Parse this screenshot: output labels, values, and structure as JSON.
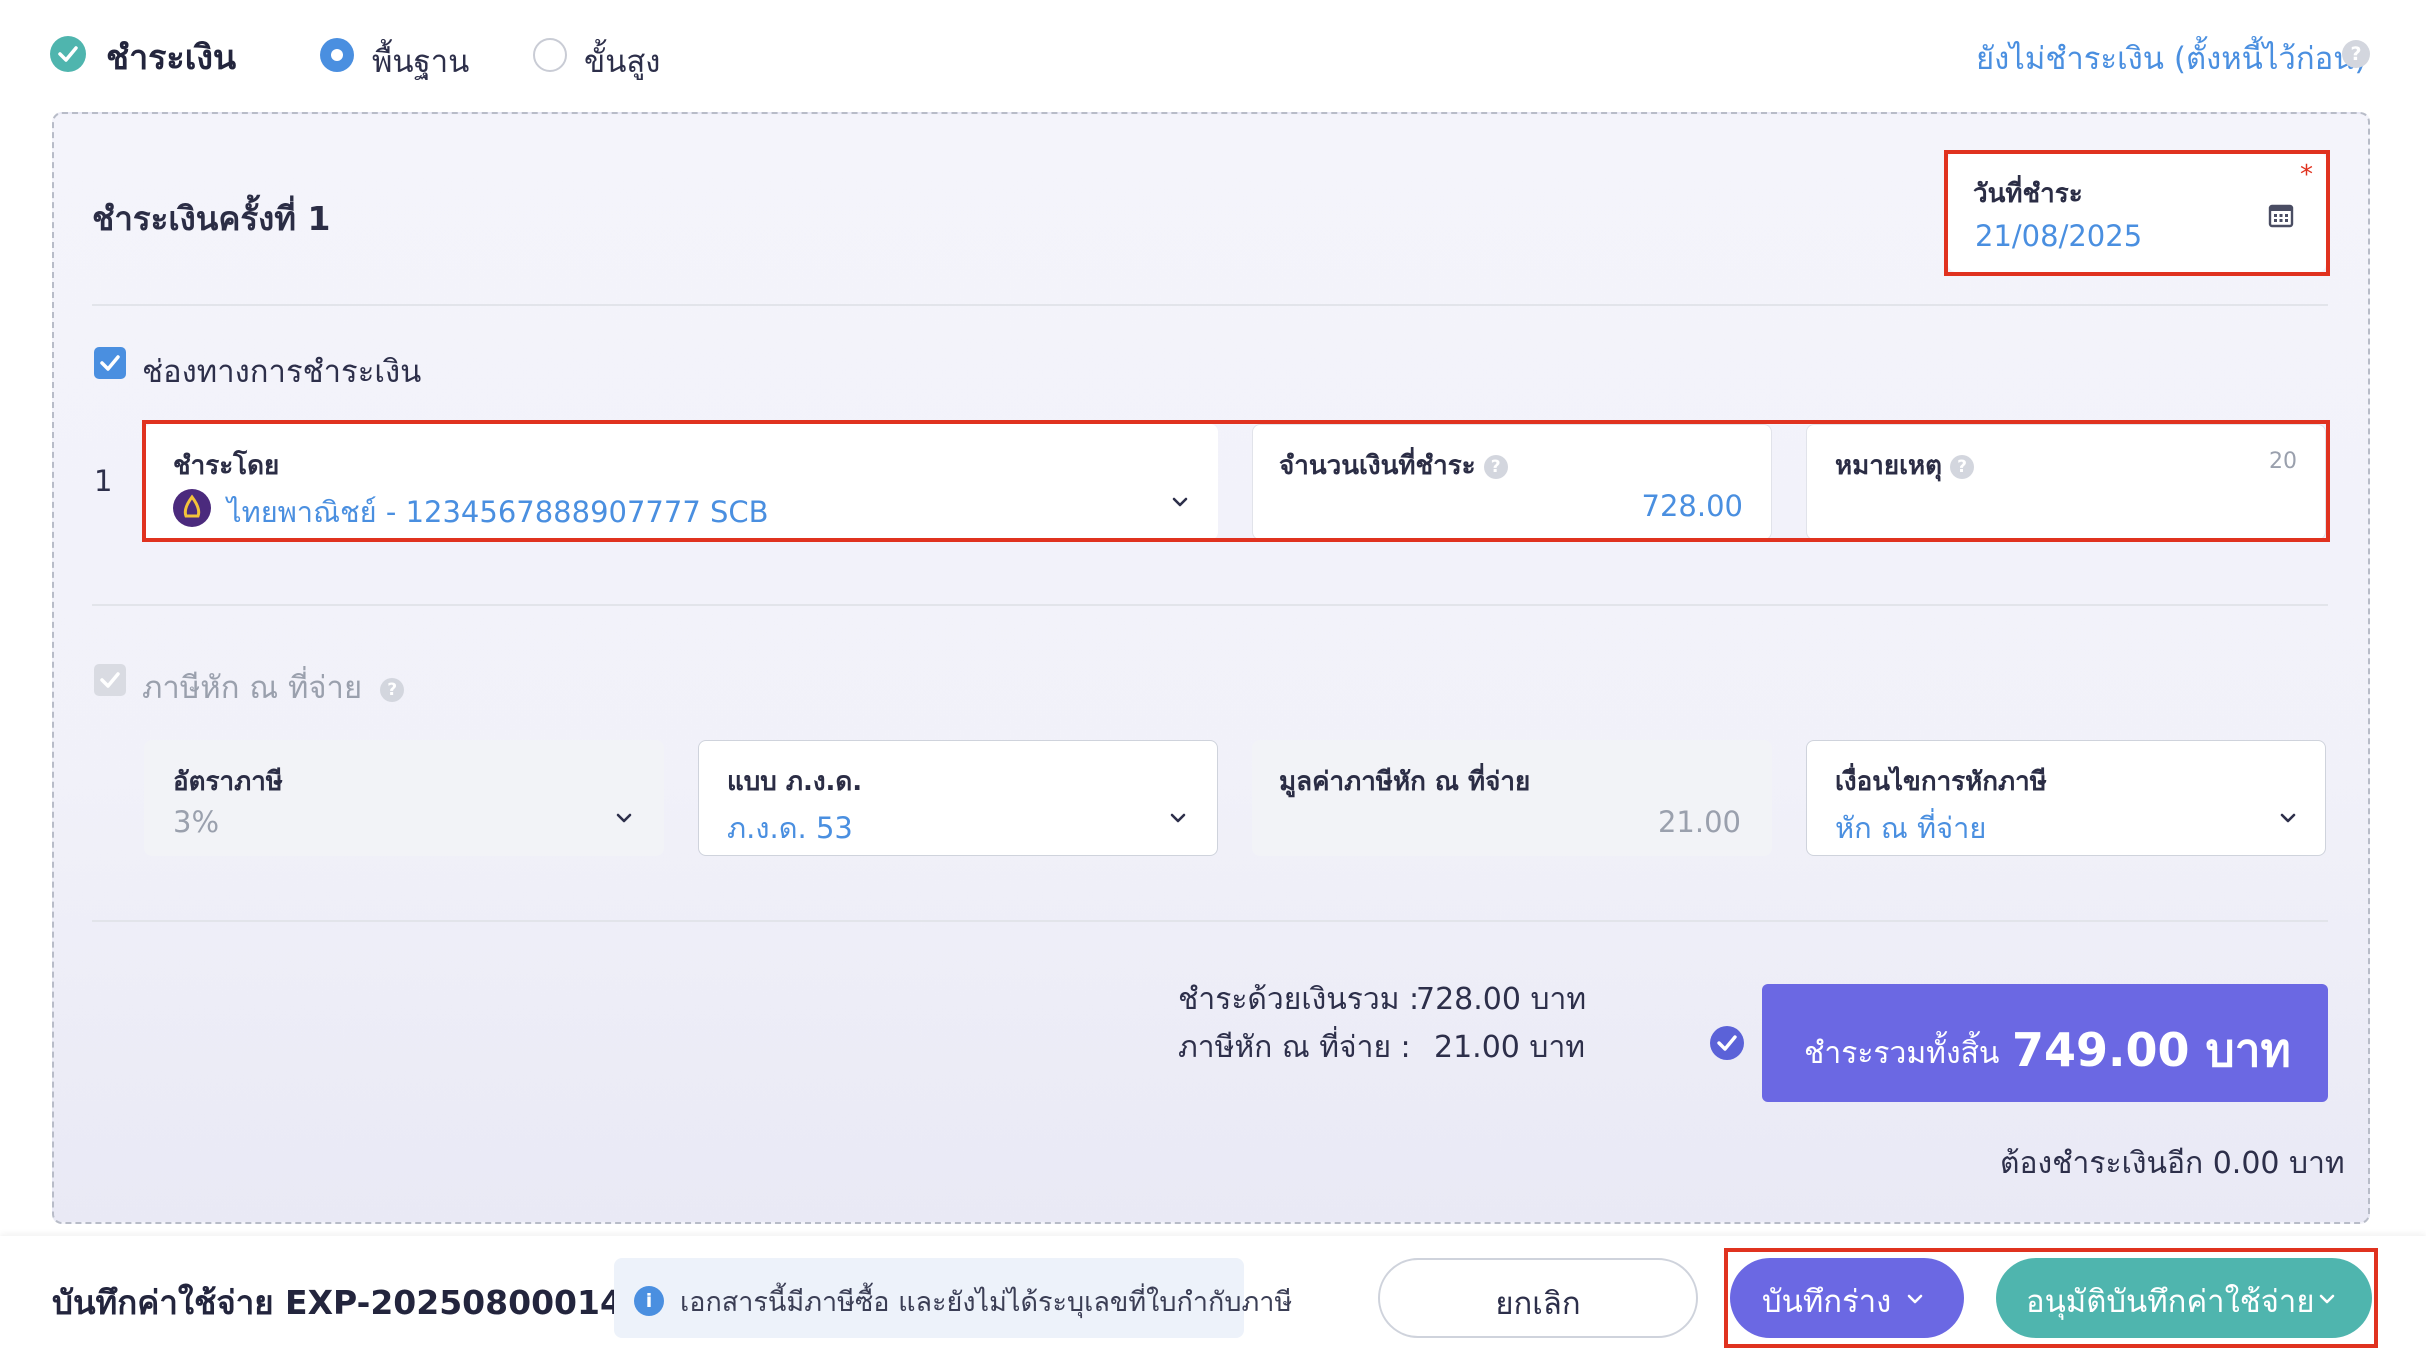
{
  "header": {
    "title": "ชำระเงิน",
    "modes": [
      {
        "label": "พื้นฐาน",
        "selected": true
      },
      {
        "label": "ขั้นสูง",
        "selected": false
      }
    ],
    "unpaid_link": "ยังไม่ชำระเงิน (ตั้งหนี้ไว้ก่อน)"
  },
  "payment": {
    "title": "ชำระเงินครั้งที่ 1",
    "date_label": "วันที่ชำระ",
    "date_value": "21/08/2025",
    "required_mark": "*",
    "channel_label": "ช่องทางการชำระเงิน",
    "row_number": "1",
    "pay_by_label": "ชำระโดย",
    "pay_by_value": "ไทยพาณิชย์ - 1234567888907777 SCB",
    "amount_label": "จำนวนเงินที่ชำระ",
    "amount_value": "728.00",
    "note_label": "หมายเหตุ",
    "note_counter": "20"
  },
  "withholding": {
    "label": "ภาษีหัก ณ ที่จ่าย",
    "rate_label": "อัตราภาษี",
    "rate_value": "3%",
    "form_label": "แบบ ภ.ง.ด.",
    "form_value": "ภ.ง.ด. 53",
    "amount_label": "มูลค่าภาษีหัก ณ ที่จ่าย",
    "amount_value": "21.00",
    "condition_label": "เงื่อนไขการหักภาษี",
    "condition_value": "หัก ณ ที่จ่าย"
  },
  "summary": {
    "cash_label": "ชำระด้วยเงินรวม :",
    "cash_value": "728.00 บาท",
    "wht_label": "ภาษีหัก ณ ที่จ่าย :",
    "wht_value": "21.00 บาท",
    "total_label": "ชำระรวมทั้งสิ้น",
    "total_value": "749.00 บาท",
    "remaining": "ต้องชำระเงินอีก 0.00 บาท"
  },
  "footer": {
    "doc_title": "บันทึกค่าใช้จ่าย EXP-20250800014",
    "info_text": "เอกสารนี้มีภาษีซื้อ และยังไม่ได้ระบุเลขที่ใบกำกับภาษี",
    "info_icon_text": "i",
    "cancel_label": "ยกเลิก",
    "draft_label": "บันทึกร่าง",
    "approve_label": "อนุมัติบันทึกค่าใช้จ่าย"
  },
  "colors": {
    "accent_purple": "#6b68e3",
    "teal": "#4fb5ae",
    "link_blue": "#4a8fe0",
    "highlight_red": "#e0321f"
  }
}
